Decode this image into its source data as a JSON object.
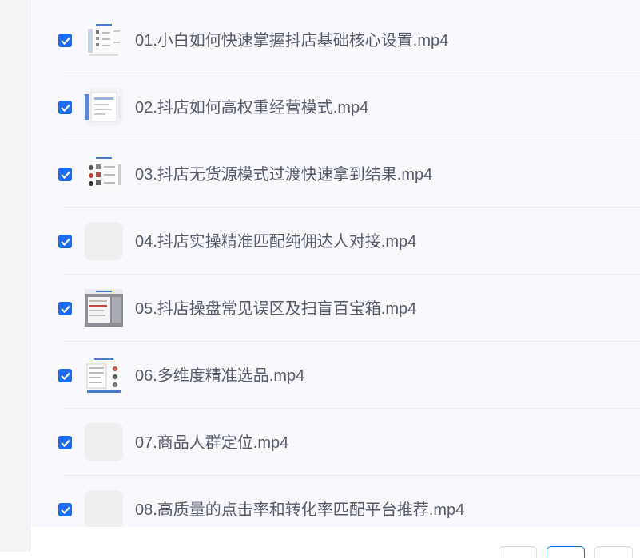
{
  "files": [
    {
      "title": "01.小白如何快速掌握抖店基础核心设置.mp4",
      "checked": true,
      "thumb": "doc-thumb-a"
    },
    {
      "title": "02.抖店如何高权重经营模式.mp4",
      "checked": true,
      "thumb": "doc-thumb-b"
    },
    {
      "title": "03.抖店无货源模式过渡快速拿到结果.mp4",
      "checked": true,
      "thumb": "doc-thumb-c"
    },
    {
      "title": "04.抖店实操精准匹配纯佣达人对接.mp4",
      "checked": true,
      "thumb": "blank-thumb"
    },
    {
      "title": "05.抖店操盘常见误区及扫盲百宝箱.mp4",
      "checked": true,
      "thumb": "doc-thumb-d"
    },
    {
      "title": "06.多维度精准选品.mp4",
      "checked": true,
      "thumb": "doc-thumb-e"
    },
    {
      "title": "07.商品人群定位.mp4",
      "checked": true,
      "thumb": "blank-thumb"
    },
    {
      "title": "08.高质量的点击率和转化率匹配平台推荐.mp4",
      "checked": true,
      "thumb": "blank-thumb"
    }
  ],
  "colors": {
    "accent": "#1a6cf0",
    "panel_bg": "#f8f8fe",
    "text": "#555a63"
  }
}
